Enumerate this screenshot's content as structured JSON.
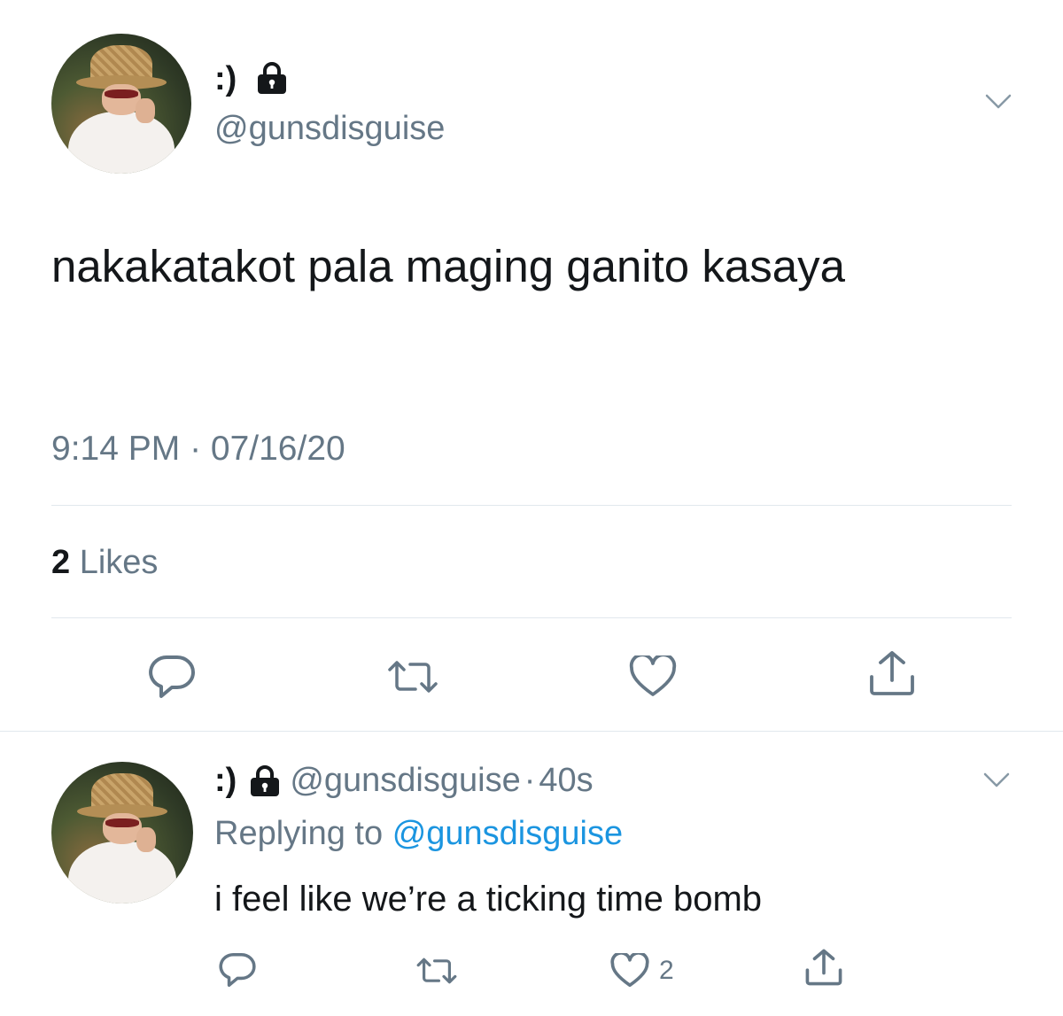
{
  "main_tweet": {
    "display_name": ":)",
    "handle": "@gunsdisguise",
    "text": "nakakatakot pala maging ganito kasaya",
    "timestamp": "9:14 PM · 07/16/20",
    "likes_count": "2",
    "likes_label": "Likes"
  },
  "reply_tweet": {
    "display_name": ":)",
    "handle": "@gunsdisguise",
    "dot": "·",
    "time": "40s",
    "replying_label": "Replying to",
    "replying_mention": "@gunsdisguise",
    "text": "i feel like we’re a ticking time bomb",
    "like_count": "2"
  },
  "icons": {
    "lock": "lock-icon",
    "chevron": "chevron-down-icon",
    "reply": "reply-icon",
    "retweet": "retweet-icon",
    "like": "heart-icon",
    "share": "share-icon"
  },
  "colors": {
    "text_primary": "#14171a",
    "text_secondary": "#657786",
    "link": "#1b95e0",
    "divider": "#e1e8ed",
    "icon": "#657786"
  }
}
